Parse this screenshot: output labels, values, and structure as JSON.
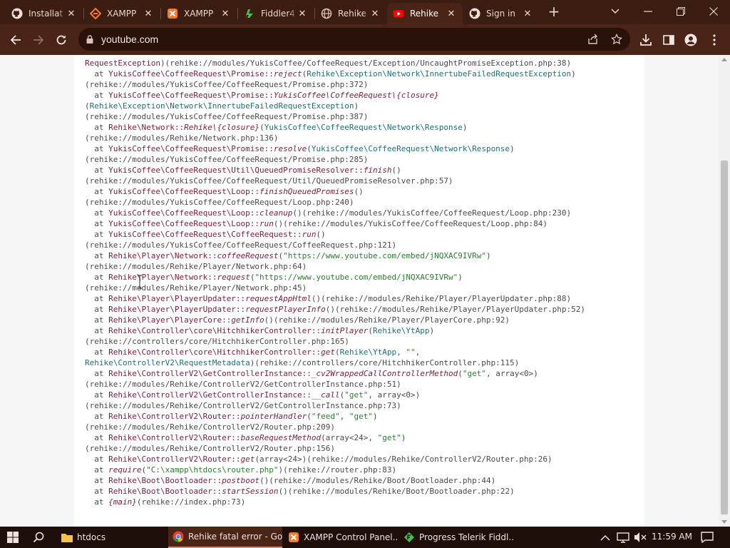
{
  "browser": {
    "tabs": [
      {
        "title": "Installat",
        "icon": "github-icon"
      },
      {
        "title": "XAMPP",
        "icon": "xampp-diamond-icon"
      },
      {
        "title": "XAMPP",
        "icon": "xampp-icon"
      },
      {
        "title": "Fiddler4",
        "icon": "fiddler-icon"
      },
      {
        "title": "Rehike",
        "icon": "globe-icon"
      },
      {
        "title": "Rehike",
        "icon": "youtube-icon",
        "active": true
      },
      {
        "title": "Sign in",
        "icon": "github-icon"
      }
    ],
    "url": "youtube.com",
    "accent": "#3c1d12"
  },
  "trace_lines": [
    [
      {
        "c": "cls",
        "t": "RequestException"
      },
      {
        "c": "plain",
        "t": ")(rehike://modules/YukisCoffee/CoffeeRequest/Exception/UncaughtPromiseException.php:38)"
      }
    ],
    [
      {
        "c": "plain",
        "t": "  at "
      },
      {
        "c": "cls",
        "t": "YukisCoffee\\CoffeeRequest\\Promise::"
      },
      {
        "c": "fn",
        "t": "reject"
      },
      {
        "c": "plain",
        "t": "("
      },
      {
        "c": "arg",
        "t": "Rehike\\Exception\\Network\\InnertubeFailedRequestException"
      },
      {
        "c": "plain",
        "t": ")"
      }
    ],
    [
      {
        "c": "plain",
        "t": "(rehike://modules/YukisCoffee/CoffeeRequest/Promise.php:372)"
      }
    ],
    [
      {
        "c": "plain",
        "t": "  at "
      },
      {
        "c": "cls",
        "t": "YukisCoffee\\CoffeeRequest\\Promise::"
      },
      {
        "c": "fn",
        "t": "YukisCoffee\\CoffeeRequest\\{closure}"
      }
    ],
    [
      {
        "c": "plain",
        "t": "("
      },
      {
        "c": "arg",
        "t": "Rehike\\Exception\\Network\\InnertubeFailedRequestException"
      },
      {
        "c": "plain",
        "t": ")"
      }
    ],
    [
      {
        "c": "plain",
        "t": "(rehike://modules/YukisCoffee/CoffeeRequest/Promise.php:387)"
      }
    ],
    [
      {
        "c": "plain",
        "t": "  at "
      },
      {
        "c": "cls",
        "t": "Rehike\\Network::"
      },
      {
        "c": "fn",
        "t": "Rehike\\{closure}"
      },
      {
        "c": "plain",
        "t": "("
      },
      {
        "c": "arg",
        "t": "YukisCoffee\\CoffeeRequest\\Network\\Response"
      },
      {
        "c": "plain",
        "t": ")"
      }
    ],
    [
      {
        "c": "plain",
        "t": "(rehike://modules/Rehike/Network.php:136)"
      }
    ],
    [
      {
        "c": "plain",
        "t": "  at "
      },
      {
        "c": "cls",
        "t": "YukisCoffee\\CoffeeRequest\\Promise::"
      },
      {
        "c": "fn",
        "t": "resolve"
      },
      {
        "c": "plain",
        "t": "("
      },
      {
        "c": "arg",
        "t": "YukisCoffee\\CoffeeRequest\\Network\\Response"
      },
      {
        "c": "plain",
        "t": ")"
      }
    ],
    [
      {
        "c": "plain",
        "t": "(rehike://modules/YukisCoffee/CoffeeRequest/Promise.php:285)"
      }
    ],
    [
      {
        "c": "plain",
        "t": "  at "
      },
      {
        "c": "cls",
        "t": "YukisCoffee\\CoffeeRequest\\Util\\QueuedPromiseResolver::"
      },
      {
        "c": "fn",
        "t": "finish"
      },
      {
        "c": "plain",
        "t": "()"
      }
    ],
    [
      {
        "c": "plain",
        "t": "(rehike://modules/YukisCoffee/CoffeeRequest/Util/QueuedPromiseResolver.php:57)"
      }
    ],
    [
      {
        "c": "plain",
        "t": "  at "
      },
      {
        "c": "cls",
        "t": "YukisCoffee\\CoffeeRequest\\Loop::"
      },
      {
        "c": "fn",
        "t": "finishQueuedPromises"
      },
      {
        "c": "plain",
        "t": "()"
      }
    ],
    [
      {
        "c": "plain",
        "t": "(rehike://modules/YukisCoffee/CoffeeRequest/Loop.php:240)"
      }
    ],
    [
      {
        "c": "plain",
        "t": "  at "
      },
      {
        "c": "cls",
        "t": "YukisCoffee\\CoffeeRequest\\Loop::"
      },
      {
        "c": "fn",
        "t": "cleanup"
      },
      {
        "c": "plain",
        "t": "()(rehike://modules/YukisCoffee/CoffeeRequest/Loop.php:230)"
      }
    ],
    [
      {
        "c": "plain",
        "t": "  at "
      },
      {
        "c": "cls",
        "t": "YukisCoffee\\CoffeeRequest\\Loop::"
      },
      {
        "c": "fn",
        "t": "run"
      },
      {
        "c": "plain",
        "t": "()(rehike://modules/YukisCoffee/CoffeeRequest/Loop.php:84)"
      }
    ],
    [
      {
        "c": "plain",
        "t": "  at "
      },
      {
        "c": "cls",
        "t": "YukisCoffee\\CoffeeRequest\\CoffeeRequest::"
      },
      {
        "c": "fn",
        "t": "run"
      },
      {
        "c": "plain",
        "t": "()"
      }
    ],
    [
      {
        "c": "plain",
        "t": "(rehike://modules/YukisCoffee/CoffeeRequest/CoffeeRequest.php:121)"
      }
    ],
    [
      {
        "c": "plain",
        "t": "  at "
      },
      {
        "c": "cls",
        "t": "Rehike\\Player\\Network::"
      },
      {
        "c": "fn",
        "t": "coffeeRequest"
      },
      {
        "c": "plain",
        "t": "("
      },
      {
        "c": "str",
        "t": "\"https://www.youtube.com/embed/jNQXAC9IVRw\""
      },
      {
        "c": "plain",
        "t": ")"
      }
    ],
    [
      {
        "c": "plain",
        "t": "(rehike://modules/Rehike/Player/Network.php:64)"
      }
    ],
    [
      {
        "c": "plain",
        "t": "  at "
      },
      {
        "c": "cls",
        "t": "Rehike\\Player\\Network::"
      },
      {
        "c": "fn",
        "t": "request"
      },
      {
        "c": "plain",
        "t": "("
      },
      {
        "c": "str",
        "t": "\"https://www.youtube.com/embed/jNQXAC9IVRw\""
      },
      {
        "c": "plain",
        "t": ")"
      }
    ],
    [
      {
        "c": "plain",
        "t": "(rehike://modules/Rehike/Player/Network.php:45)"
      }
    ],
    [
      {
        "c": "plain",
        "t": "  at "
      },
      {
        "c": "cls",
        "t": "Rehike\\Player\\PlayerUpdater::"
      },
      {
        "c": "fn",
        "t": "requestAppHtml"
      },
      {
        "c": "plain",
        "t": "()(rehike://modules/Rehike/Player/PlayerUpdater.php:88)"
      }
    ],
    [
      {
        "c": "plain",
        "t": "  at "
      },
      {
        "c": "cls",
        "t": "Rehike\\Player\\PlayerUpdater::"
      },
      {
        "c": "fn",
        "t": "requestPlayerInfo"
      },
      {
        "c": "plain",
        "t": "()(rehike://modules/Rehike/Player/PlayerUpdater.php:52)"
      }
    ],
    [
      {
        "c": "plain",
        "t": "  at "
      },
      {
        "c": "cls",
        "t": "Rehike\\Player\\PlayerCore::"
      },
      {
        "c": "fn",
        "t": "getInfo"
      },
      {
        "c": "plain",
        "t": "()(rehike://modules/Rehike/Player/PlayerCore.php:92)"
      }
    ],
    [
      {
        "c": "plain",
        "t": "  at "
      },
      {
        "c": "cls",
        "t": "Rehike\\Controller\\core\\HitchhikerController::"
      },
      {
        "c": "fn",
        "t": "initPlayer"
      },
      {
        "c": "plain",
        "t": "("
      },
      {
        "c": "arg",
        "t": "Rehike\\YtApp"
      },
      {
        "c": "plain",
        "t": ")"
      }
    ],
    [
      {
        "c": "plain",
        "t": "(rehike://controllers/core/HitchhikerController.php:165)"
      }
    ],
    [
      {
        "c": "plain",
        "t": "  at "
      },
      {
        "c": "cls",
        "t": "Rehike\\Controller\\core\\HitchhikerController::"
      },
      {
        "c": "fn",
        "t": "get"
      },
      {
        "c": "plain",
        "t": "("
      },
      {
        "c": "arg",
        "t": "Rehike\\YtApp"
      },
      {
        "c": "plain",
        "t": ", "
      },
      {
        "c": "str",
        "t": "\"\""
      },
      {
        "c": "plain",
        "t": ","
      }
    ],
    [
      {
        "c": "arg",
        "t": "Rehike\\ControllerV2\\RequestMetadata"
      },
      {
        "c": "plain",
        "t": ")(rehike://controllers/core/HitchhikerController.php:115)"
      }
    ],
    [
      {
        "c": "plain",
        "t": "  at "
      },
      {
        "c": "cls",
        "t": "Rehike\\ControllerV2\\GetControllerInstance::"
      },
      {
        "c": "fn",
        "t": "_cv2WrappedCallControllerMethod"
      },
      {
        "c": "plain",
        "t": "("
      },
      {
        "c": "str",
        "t": "\"get\""
      },
      {
        "c": "plain",
        "t": ", array<0>)"
      }
    ],
    [
      {
        "c": "plain",
        "t": "(rehike://modules/Rehike/ControllerV2/GetControllerInstance.php:51)"
      }
    ],
    [
      {
        "c": "plain",
        "t": "  at "
      },
      {
        "c": "cls",
        "t": "Rehike\\ControllerV2\\GetControllerInstance::"
      },
      {
        "c": "fn",
        "t": "__call"
      },
      {
        "c": "plain",
        "t": "("
      },
      {
        "c": "str",
        "t": "\"get\""
      },
      {
        "c": "plain",
        "t": ", array<0>)"
      }
    ],
    [
      {
        "c": "plain",
        "t": "(rehike://modules/Rehike/ControllerV2/GetControllerInstance.php:73)"
      }
    ],
    [
      {
        "c": "plain",
        "t": "  at "
      },
      {
        "c": "cls",
        "t": "Rehike\\ControllerV2\\Router::"
      },
      {
        "c": "fn",
        "t": "pointerHandler"
      },
      {
        "c": "plain",
        "t": "("
      },
      {
        "c": "str",
        "t": "\"feed\""
      },
      {
        "c": "plain",
        "t": ", "
      },
      {
        "c": "str",
        "t": "\"get\""
      },
      {
        "c": "plain",
        "t": ")"
      }
    ],
    [
      {
        "c": "plain",
        "t": "(rehike://modules/Rehike/ControllerV2/Router.php:209)"
      }
    ],
    [
      {
        "c": "plain",
        "t": "  at "
      },
      {
        "c": "cls",
        "t": "Rehike\\ControllerV2\\Router::"
      },
      {
        "c": "fn",
        "t": "baseRequestMethod"
      },
      {
        "c": "plain",
        "t": "(array<24>, "
      },
      {
        "c": "str",
        "t": "\"get\""
      },
      {
        "c": "plain",
        "t": ")"
      }
    ],
    [
      {
        "c": "plain",
        "t": "(rehike://modules/Rehike/ControllerV2/Router.php:156)"
      }
    ],
    [
      {
        "c": "plain",
        "t": "  at "
      },
      {
        "c": "cls",
        "t": "Rehike\\ControllerV2\\Router::"
      },
      {
        "c": "fn",
        "t": "get"
      },
      {
        "c": "plain",
        "t": "(array<24>)(rehike://modules/Rehike/ControllerV2/Router.php:26)"
      }
    ],
    [
      {
        "c": "plain",
        "t": "  at "
      },
      {
        "c": "fn",
        "t": "require"
      },
      {
        "c": "plain",
        "t": "("
      },
      {
        "c": "str",
        "t": "\"C:\\xampp\\htdocs\\router.php\""
      },
      {
        "c": "plain",
        "t": ")(rehike://router.php:83)"
      }
    ],
    [
      {
        "c": "plain",
        "t": "  at "
      },
      {
        "c": "cls",
        "t": "Rehike\\Boot\\Bootloader::"
      },
      {
        "c": "fn",
        "t": "postboot"
      },
      {
        "c": "plain",
        "t": "()(rehike://modules/Rehike/Boot/Bootloader.php:44)"
      }
    ],
    [
      {
        "c": "plain",
        "t": "  at "
      },
      {
        "c": "cls",
        "t": "Rehike\\Boot\\Bootloader::"
      },
      {
        "c": "fn",
        "t": "startSession"
      },
      {
        "c": "plain",
        "t": "()(rehike://modules/Rehike/Boot/Bootloader.php:22)"
      }
    ],
    [
      {
        "c": "plain",
        "t": "  at "
      },
      {
        "c": "fn",
        "t": "{main}"
      },
      {
        "c": "plain",
        "t": "(rehike://index.php:73)"
      }
    ]
  ],
  "taskbar": {
    "items": [
      {
        "label": "htdocs",
        "icon": "folder-icon"
      },
      {
        "label": "Rehike fatal error - Go...",
        "icon": "chrome-icon",
        "active": true
      },
      {
        "label": "XAMPP Control Panel...",
        "icon": "xampp-icon"
      },
      {
        "label": "Progress Telerik Fiddl...",
        "icon": "fiddler-icon"
      }
    ],
    "clock": "11:59 AM"
  }
}
